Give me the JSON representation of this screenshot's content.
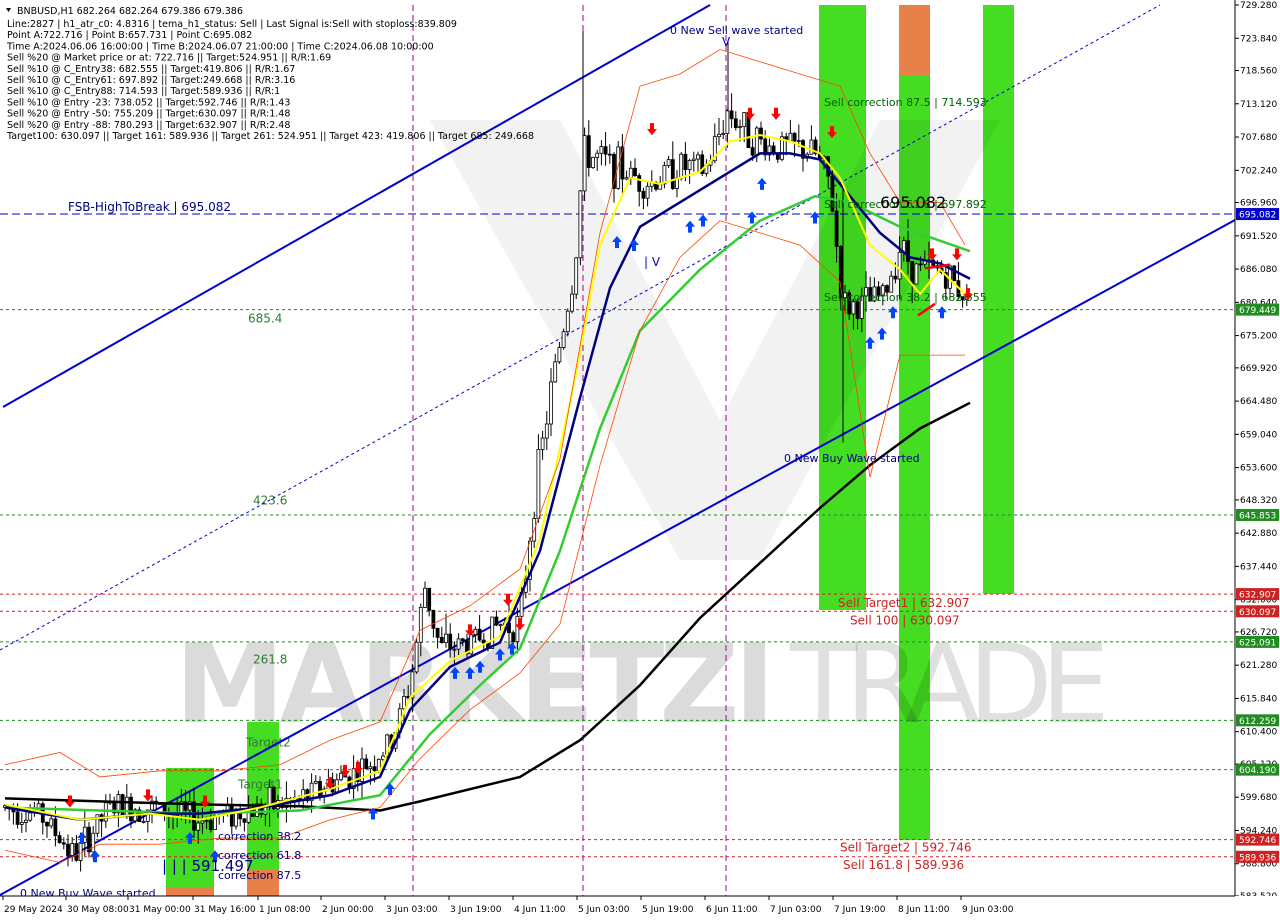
{
  "chart_data": {
    "type": "candlestick",
    "symbol_header": "BNBUSD,H1  682.264 682.264 679.386 679.386",
    "info_lines": [
      "Line:2827 | h1_atr_c0: 4.8316 | tema_h1_status: Sell | Last Signal is:Sell with stoploss:839.809",
      "Point A:722.716 | Point B:657.731 | Point C:695.082",
      "Time A:2024.06.06 16:00:00 | Time B:2024.06.07 21:00:00 | Time C:2024.06.08 10:00:00",
      "Sell %20 @ Market price or at: 722.716 || Target:524.951 || R/R:1.69",
      "Sell %10 @ C_Entry38: 682.555 || Target:419.806 || R/R:1.67",
      "Sell %10 @ C_Entry61: 697.892 || Target:249.668 || R/R:3.16",
      "Sell %10 @ C_Entry88: 714.593 || Target:589.936 || R/R:1",
      "Sell %10 @ Entry -23: 738.052 || Target:592.746 || R/R:1.43",
      "Sell %20 @ Entry -50: 755.209 || Target:630.097 || R/R:1.48",
      "Sell %20 @ Entry -88: 780.293 || Target:632.907 || R/R:2.48",
      "Target100: 630.097 || Target 161: 589.936 || Target 261: 524.951 || Target 423: 419.806 || Target 685: 249.668"
    ],
    "ylim": [
      583.52,
      729.28
    ],
    "y_ticks": [
      "729.280",
      "723.840",
      "718.560",
      "713.120",
      "707.680",
      "702.240",
      "696.960",
      "691.520",
      "686.080",
      "680.640",
      "675.200",
      "669.920",
      "664.480",
      "659.040",
      "653.600",
      "648.320",
      "642.880",
      "637.440",
      "632.000",
      "626.720",
      "621.280",
      "615.840",
      "610.400",
      "605.120",
      "599.680",
      "594.240",
      "588.800",
      "583.520"
    ],
    "x_ticks": [
      "29 May 2024",
      "30 May 08:00",
      "31 May 00:00",
      "31 May 16:00",
      "1 Jun 08:00",
      "2 Jun 00:00",
      "3 Jun 03:00",
      "3 Jun 19:00",
      "4 Jun 11:00",
      "5 Jun 03:00",
      "5 Jun 19:00",
      "6 Jun 11:00",
      "7 Jun 03:00",
      "7 Jun 19:00",
      "8 Jun 11:00",
      "9 Jun 03:00"
    ],
    "current_price": "679.449",
    "horizontal_levels": [
      {
        "price": 695.082,
        "tag": "695.082",
        "color": "#0000cc",
        "style": "dashed",
        "label": "FSB-HighToBreak | 695.082"
      },
      {
        "price": 679.449,
        "tag": "679.449",
        "color": "#228b22",
        "style": "dotted",
        "label": ""
      },
      {
        "price": 645.853,
        "tag": "645.853",
        "color": "#228b22",
        "style": "dotted",
        "label": ""
      },
      {
        "price": 632.907,
        "tag": "632.907",
        "color": "#cc2222",
        "style": "dotted",
        "label": "Sell Target1 | 632.907"
      },
      {
        "price": 630.097,
        "tag": "630.097",
        "color": "#cc2222",
        "style": "dotted",
        "label": "Sell 100 | 630.097"
      },
      {
        "price": 625.091,
        "tag": "625.091",
        "color": "#228b22",
        "style": "dotted",
        "label": ""
      },
      {
        "price": 612.259,
        "tag": "612.259",
        "color": "#228b22",
        "style": "dotted",
        "label": ""
      },
      {
        "price": 604.19,
        "tag": "604.190",
        "color": "#228b22",
        "style": "dotted",
        "label": ""
      },
      {
        "price": 592.746,
        "tag": "592.746",
        "color": "#cc2222",
        "style": "dotted",
        "label": "Sell Target2 | 592.746"
      },
      {
        "price": 589.936,
        "tag": "589.936",
        "color": "#cc2222",
        "style": "dotted",
        "label": "Sell 161.8 | 589.936"
      }
    ],
    "fib_labels": [
      {
        "text": "685.4",
        "price": 678.0
      },
      {
        "text": "423.6",
        "price": 648.2
      },
      {
        "text": "261.8",
        "price": 622.2
      },
      {
        "text": "Target2",
        "price": 608.6
      },
      {
        "text": "Target1",
        "price": 601.8
      }
    ],
    "annotations": [
      {
        "text": "0 New Sell wave started",
        "color": "#000080"
      },
      {
        "text": "0 New Buy Wave started",
        "color": "#000080"
      },
      {
        "text": "0 New Buy Wave started",
        "color": "#000080"
      },
      {
        "text": "Sell correction 87.5 | 714.593",
        "color": "#006400"
      },
      {
        "text": "Sell correction 61.8 | 697.892",
        "color": "#006400"
      },
      {
        "text": "Sell correction 38.2 | 682.555",
        "color": "#006400"
      },
      {
        "text": "695.082",
        "color": "#000000"
      },
      {
        "text": "correction 38.2",
        "color": "#000080"
      },
      {
        "text": "correction 61.8",
        "color": "#000080"
      },
      {
        "text": "correction 87.5",
        "color": "#000080"
      },
      {
        "text": "| | | 591.497",
        "color": "#000080"
      },
      {
        "text": "V",
        "color": "#0000cc"
      },
      {
        "text": "| V",
        "color": "#0000cc"
      }
    ],
    "watermark": "MARKETZITRADE",
    "colors": {
      "trend_blue": "#0000cc",
      "ma_black": "#000000",
      "ma_green": "#33cc33",
      "ma_navy": "#000080",
      "ma_yellow": "#ffff00",
      "zone_green": "#44dd22",
      "zone_orange": "#e8804a",
      "buy_arrow": "#0044ff",
      "sell_arrow": "#ff0000",
      "candle": "#000000"
    }
  }
}
